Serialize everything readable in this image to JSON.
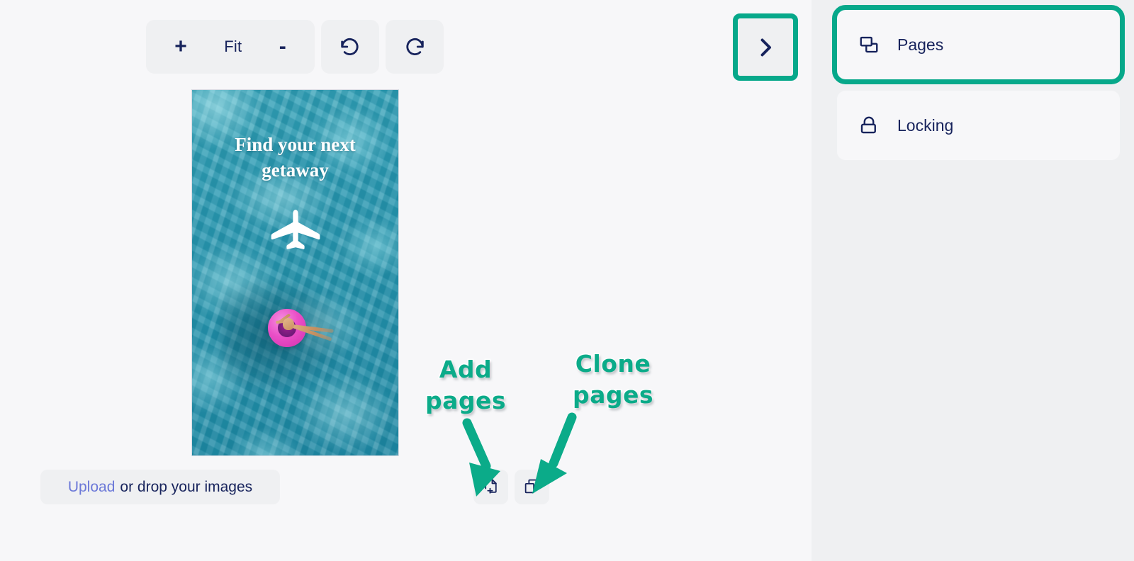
{
  "app": {
    "accent_green": "#06a88a",
    "navy": "#17235c",
    "canvas_bg": "#f7f7f9",
    "panel_bg": "#eff0f2",
    "link_color": "#6b78d8"
  },
  "toolbar": {
    "zoom_in_label": "+",
    "fit_label": "Fit",
    "zoom_out_label": "-",
    "zoom_in_icon": "plus-icon",
    "zoom_out_icon": "minus-icon",
    "undo_icon": "undo-icon",
    "redo_icon": "redo-icon"
  },
  "panel_toggle": {
    "icon": "chevron-right-icon",
    "highlighted": true
  },
  "artboard": {
    "headline": "Find your next getaway",
    "plane_icon": "airplane-icon",
    "image_description": "aerial photo of turquoise pool water with person on pink float ring"
  },
  "upload": {
    "link_label": "Upload",
    "rest_label": "or drop your images"
  },
  "page_actions": [
    {
      "name": "add-pages-button",
      "icon": "document-plus-icon"
    },
    {
      "name": "clone-pages-button",
      "icon": "copy-pages-icon"
    }
  ],
  "annotations": [
    {
      "name": "add-pages-annotation",
      "text": "Add\npages",
      "line1": "Add",
      "line2": "pages",
      "color": "#0bab89"
    },
    {
      "name": "clone-pages-annotation",
      "text": "Clone\npages",
      "line1": "Clone",
      "line2": "pages",
      "color": "#0bab89"
    }
  ],
  "side_panel": {
    "items": [
      {
        "label": "Pages",
        "icon": "pages-icon",
        "highlighted": true
      },
      {
        "label": "Locking",
        "icon": "lock-icon",
        "highlighted": false
      }
    ]
  }
}
